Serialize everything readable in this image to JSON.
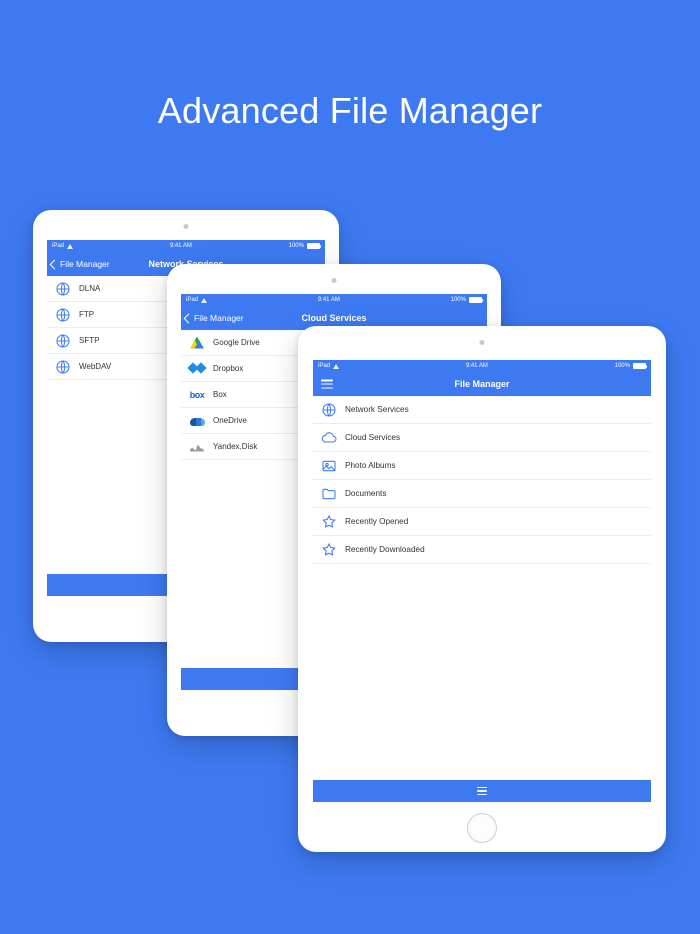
{
  "headline": "Advanced File Manager",
  "status": {
    "carrier": "iPad",
    "time": "9:41 AM",
    "battery": "100%"
  },
  "back_label": "File Manager",
  "screens": {
    "network": {
      "title": "Network Services",
      "items": [
        "DLNA",
        "FTP",
        "SFTP",
        "WebDAV"
      ]
    },
    "cloud": {
      "title": "Cloud Services",
      "items": [
        "Google Drive",
        "Dropbox",
        "Box",
        "OneDrive",
        "Yandex.Disk"
      ]
    },
    "main": {
      "title": "File Manager",
      "items": [
        "Network Services",
        "Cloud Services",
        "Photo Albums",
        "Documents",
        "Recently Opened",
        "Recently Downloaded"
      ]
    }
  }
}
